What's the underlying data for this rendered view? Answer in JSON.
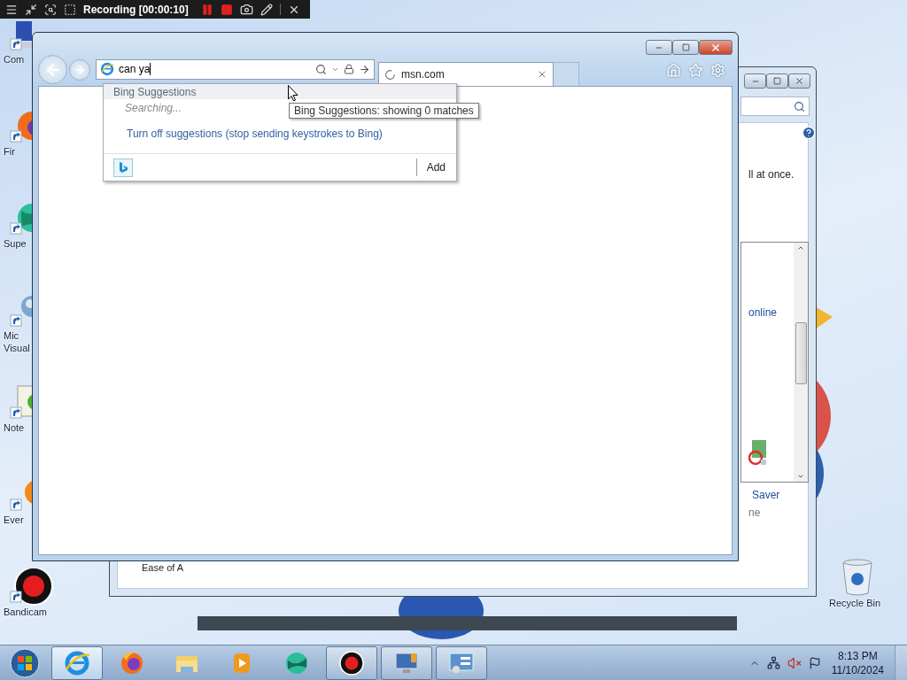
{
  "recorder": {
    "title": "Recording [00:00:10]"
  },
  "desktop_icons": [
    {
      "kind": "computer",
      "label": "Com"
    },
    {
      "kind": "firefox",
      "label": "Fir"
    },
    {
      "kind": "globe",
      "label": "Supe"
    },
    {
      "kind": "studio",
      "label": "Mic\nVisual"
    },
    {
      "kind": "notepad",
      "label": "Note"
    },
    {
      "kind": "search",
      "label": "Ever"
    },
    {
      "kind": "recorder",
      "label": "Bandicam"
    }
  ],
  "recycle_bin": {
    "label": "Recycle Bin"
  },
  "back_window": {
    "note": "ll at once.",
    "link": "online",
    "item_title": "Saver",
    "item_sub": "ne",
    "footer": "Ease of A"
  },
  "browser": {
    "address": "can ya",
    "tab": {
      "title": "msn.com"
    },
    "suggestions": {
      "header": "Bing Suggestions",
      "status": "Searching...",
      "turn_off": "Turn off suggestions (stop sending keystrokes to Bing)",
      "add": "Add"
    },
    "tooltip": "Bing Suggestions: showing 0 matches"
  },
  "taskbar": {
    "apps": [
      {
        "kind": "ie",
        "running": true,
        "active": true
      },
      {
        "kind": "firefox",
        "running": false,
        "active": false
      },
      {
        "kind": "folder",
        "running": false,
        "active": false
      },
      {
        "kind": "player",
        "running": false,
        "active": false
      },
      {
        "kind": "globe",
        "running": false,
        "active": false
      },
      {
        "kind": "recorder",
        "running": true,
        "active": false
      },
      {
        "kind": "monitor",
        "running": true,
        "active": false
      },
      {
        "kind": "panel",
        "running": true,
        "active": false
      }
    ],
    "volume_muted": true,
    "clock": {
      "time": "8:13 PM",
      "date": "11/10/2024"
    }
  }
}
